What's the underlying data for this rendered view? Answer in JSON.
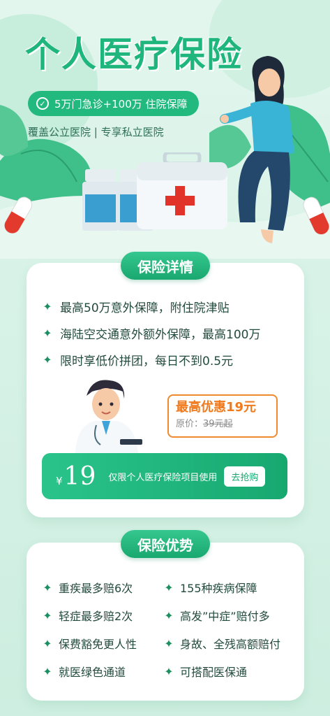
{
  "hero": {
    "title": "个人医疗保险",
    "pill_text": "5万门急诊+100万 住院保障",
    "subtitle": "覆盖公立医院 | 专享私立医院"
  },
  "details": {
    "heading": "保险详情",
    "features": [
      "最高50万意外保障，附住院津贴",
      "海陆空交通意外额外保障，最高100万",
      "限时享低价拼团，每日不到0.5元"
    ],
    "promo": {
      "title": "最高优惠19元",
      "original_prefix": "原价：",
      "original_price": "39元起"
    },
    "coupon": {
      "currency": "¥",
      "amount": "19",
      "description": "仅限个人医疗保险项目使用",
      "button": "去抢购"
    }
  },
  "advantages": {
    "heading": "保险优势",
    "left": [
      "重疾最多赔6次",
      "轻症最多赔2次",
      "保费豁免更人性",
      "就医绿色通道"
    ],
    "right": [
      "155种疾病保障",
      "高发”中症”赔付多",
      "身故、全残高额赔付",
      "可搭配医保通"
    ]
  },
  "colors": {
    "brand_green": "#1fb67e",
    "accent_orange": "#f07a1c",
    "background": "#d8f2e7"
  }
}
